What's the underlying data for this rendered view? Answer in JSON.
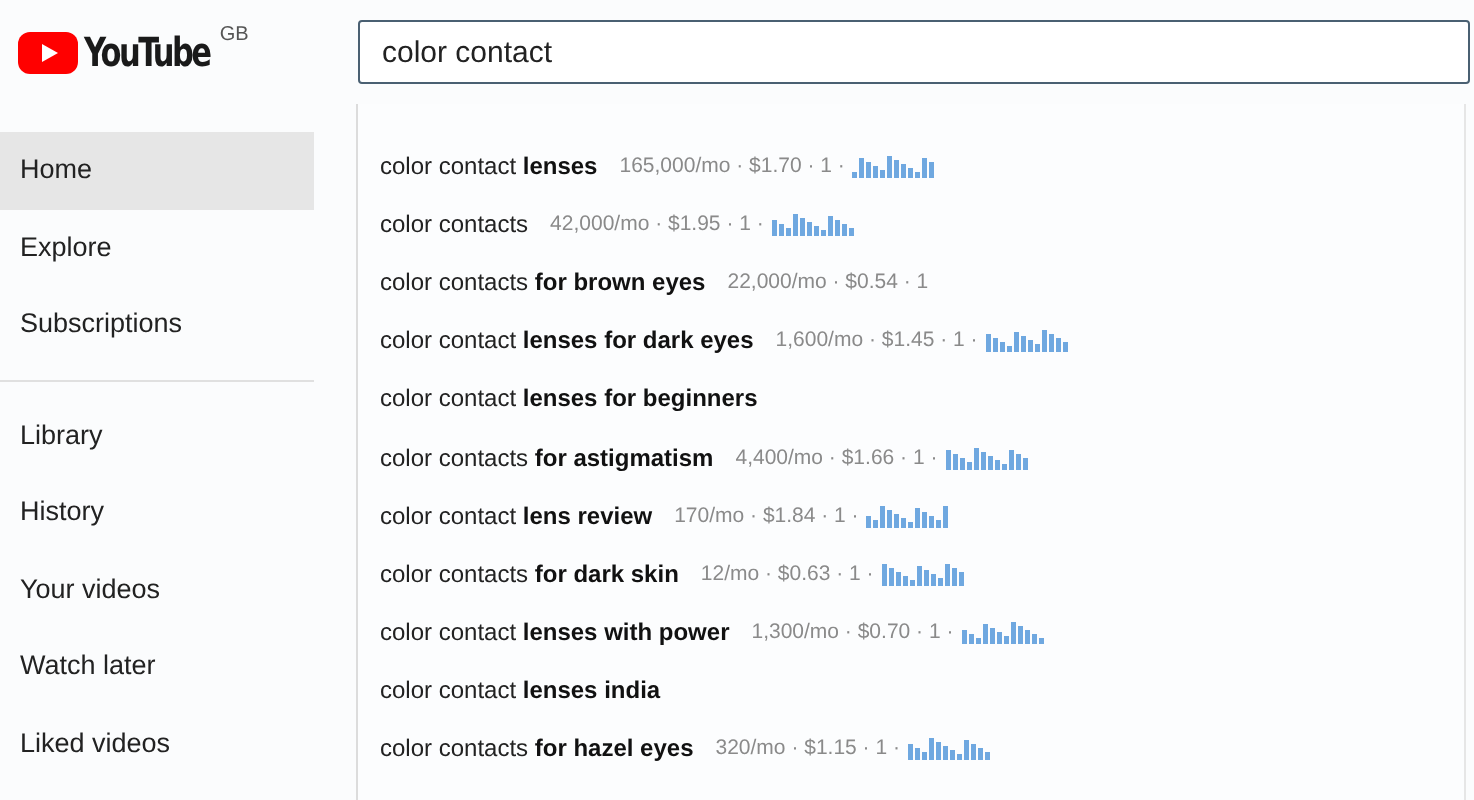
{
  "logo": {
    "wordmark": "YouTube",
    "region": "GB"
  },
  "search": {
    "value": "color contact"
  },
  "sidebar": {
    "sections": [
      {
        "items": [
          {
            "label": "Home",
            "selected": true
          },
          {
            "label": "Explore",
            "selected": false
          },
          {
            "label": "Subscriptions",
            "selected": false
          }
        ]
      },
      {
        "items": [
          {
            "label": "Library",
            "selected": false
          },
          {
            "label": "History",
            "selected": false
          },
          {
            "label": "Your videos",
            "selected": false
          },
          {
            "label": "Watch later",
            "selected": false
          },
          {
            "label": "Liked videos",
            "selected": false
          }
        ]
      }
    ]
  },
  "suggestions": [
    {
      "text": "color contact **lenses**",
      "metrics": "165,000/mo · $1.70 · 1 ·",
      "trend": true
    },
    {
      "text": "color contacts",
      "metrics": "42,000/mo · $1.95 · 1 ·",
      "trend": true
    },
    {
      "text": "color contacts **for brown eyes**",
      "metrics": "22,000/mo · $0.54 · 1",
      "trend": false
    },
    {
      "text": "color contact **lenses for dark eyes**",
      "metrics": "1,600/mo · $1.45 · 1 ·",
      "trend": true
    },
    {
      "text": "color contact **lenses for beginners**"
    },
    {
      "text": "color contacts **for astigmatism**",
      "metrics": "4,400/mo · $1.66 · 1 ·",
      "trend": true
    },
    {
      "text": "color contact **lens review**",
      "metrics": "170/mo · $1.84 · 1 ·",
      "trend": true
    },
    {
      "text": "color contacts **for dark skin**",
      "metrics": "12/mo · $0.63 · 1 ·",
      "trend": true
    },
    {
      "text": "color contact **lenses with power**",
      "metrics": "1,300/mo · $0.70 · 1 ·",
      "trend": true
    },
    {
      "text": "color contact **lenses india**"
    },
    {
      "text": "color contacts **for hazel eyes**",
      "metrics": "320/mo · $1.15 · 1 ·",
      "trend": true
    }
  ]
}
